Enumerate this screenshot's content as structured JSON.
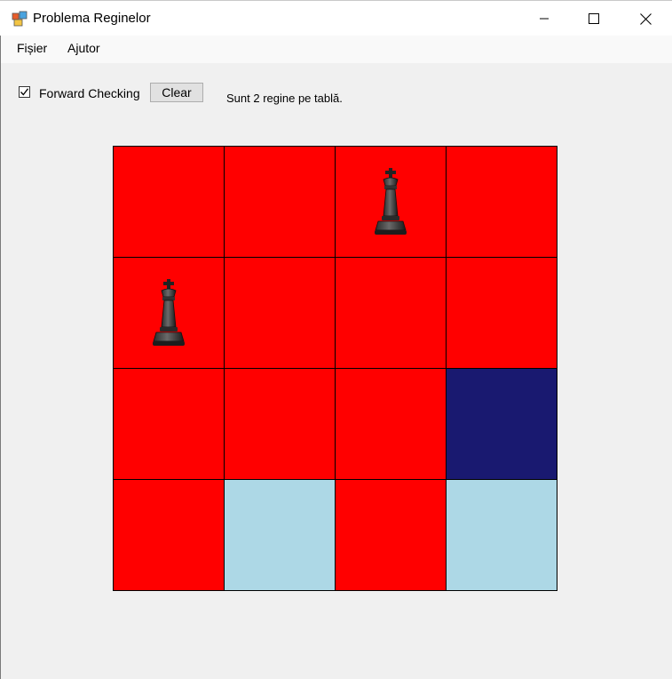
{
  "window": {
    "title": "Problema Reginelor",
    "icon": "app-icon",
    "controls": [
      "minimize-icon",
      "maximize-icon",
      "close-icon"
    ]
  },
  "menu": {
    "items": [
      {
        "label": "Fișier"
      },
      {
        "label": "Ajutor"
      }
    ]
  },
  "toolbar": {
    "forward_checking_label": "Forward Checking",
    "forward_checking_checked": true,
    "clear_label": "Clear",
    "status_text": "Sunt 2 regine pe tablă."
  },
  "colors": {
    "attacked": "#ff0000",
    "free": "#add8e6",
    "highlight": "#191970"
  },
  "board": {
    "size": 4,
    "cells": [
      [
        "attacked",
        "attacked",
        "attacked",
        "attacked"
      ],
      [
        "attacked",
        "attacked",
        "attacked",
        "attacked"
      ],
      [
        "attacked",
        "attacked",
        "attacked",
        "highlight"
      ],
      [
        "attacked",
        "free",
        "attacked",
        "free"
      ]
    ],
    "queens": [
      {
        "row": 0,
        "col": 2
      },
      {
        "row": 1,
        "col": 0
      }
    ]
  }
}
